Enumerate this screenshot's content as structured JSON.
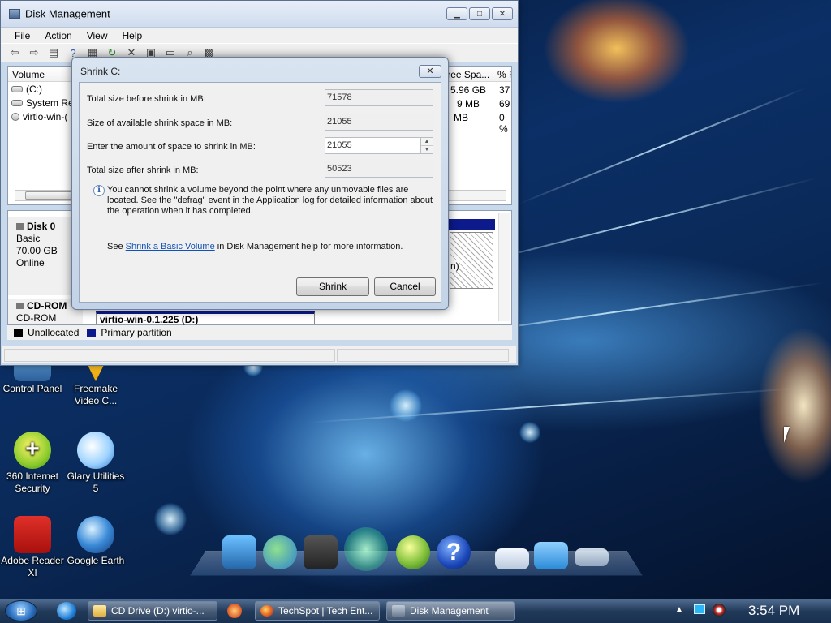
{
  "window": {
    "title": "Disk Management",
    "menu": [
      "File",
      "Action",
      "View",
      "Help"
    ],
    "volumes": {
      "headers": [
        "Volume",
        "ree Spa...",
        "% F"
      ],
      "rows": [
        {
          "name": "(C:)",
          "free": "5.96 GB",
          "pct": "37"
        },
        {
          "name": "System Res",
          "free": "9 MB",
          "pct": "69"
        },
        {
          "name": "virtio-win-(",
          "free": "MB",
          "pct": "0 %"
        }
      ]
    },
    "disks": [
      {
        "name": "Disk 0",
        "lines": [
          "Basic",
          "70.00 GB",
          "Online"
        ]
      },
      {
        "name": "CD-ROM",
        "lines": [
          "CD-ROM"
        ]
      }
    ],
    "partition_fragment": "n)",
    "cd_volume": "virtio-win-0.1.225  (D:)",
    "legend": [
      {
        "label": "Unallocated",
        "color": "#000000"
      },
      {
        "label": "Primary partition",
        "color": "#0c1a8c"
      }
    ]
  },
  "dialog": {
    "title": "Shrink C:",
    "fields": [
      {
        "label": "Total size before shrink in MB:",
        "value": "71578"
      },
      {
        "label": "Size of available shrink space in MB:",
        "value": "21055"
      },
      {
        "label": "Enter the amount of space to shrink in MB:",
        "value": "21055"
      },
      {
        "label": "Total size after shrink in MB:",
        "value": "50523"
      }
    ],
    "info": "You cannot shrink a volume beyond the point where any unmovable files are located. See the \"defrag\" event in the Application log for detailed information about the operation when it has completed.",
    "see_prefix": "See ",
    "see_link": "Shrink a Basic Volume",
    "see_suffix": " in Disk Management help for more information.",
    "shrink_label": "Shrink",
    "cancel_label": "Cancel"
  },
  "desktop_icons": [
    {
      "label": "Control Panel"
    },
    {
      "label": "Freemake Video C..."
    },
    {
      "label": "360 Internet Security"
    },
    {
      "label": "Glary Utilities 5"
    },
    {
      "label": "Adobe Reader XI"
    },
    {
      "label": "Google Earth"
    }
  ],
  "taskbar": {
    "items": [
      {
        "label": "CD Drive (D:) virtio-..."
      },
      {
        "label": "TechSpot | Tech Ent..."
      },
      {
        "label": "Disk Management"
      }
    ],
    "clock": "3:54 PM"
  }
}
